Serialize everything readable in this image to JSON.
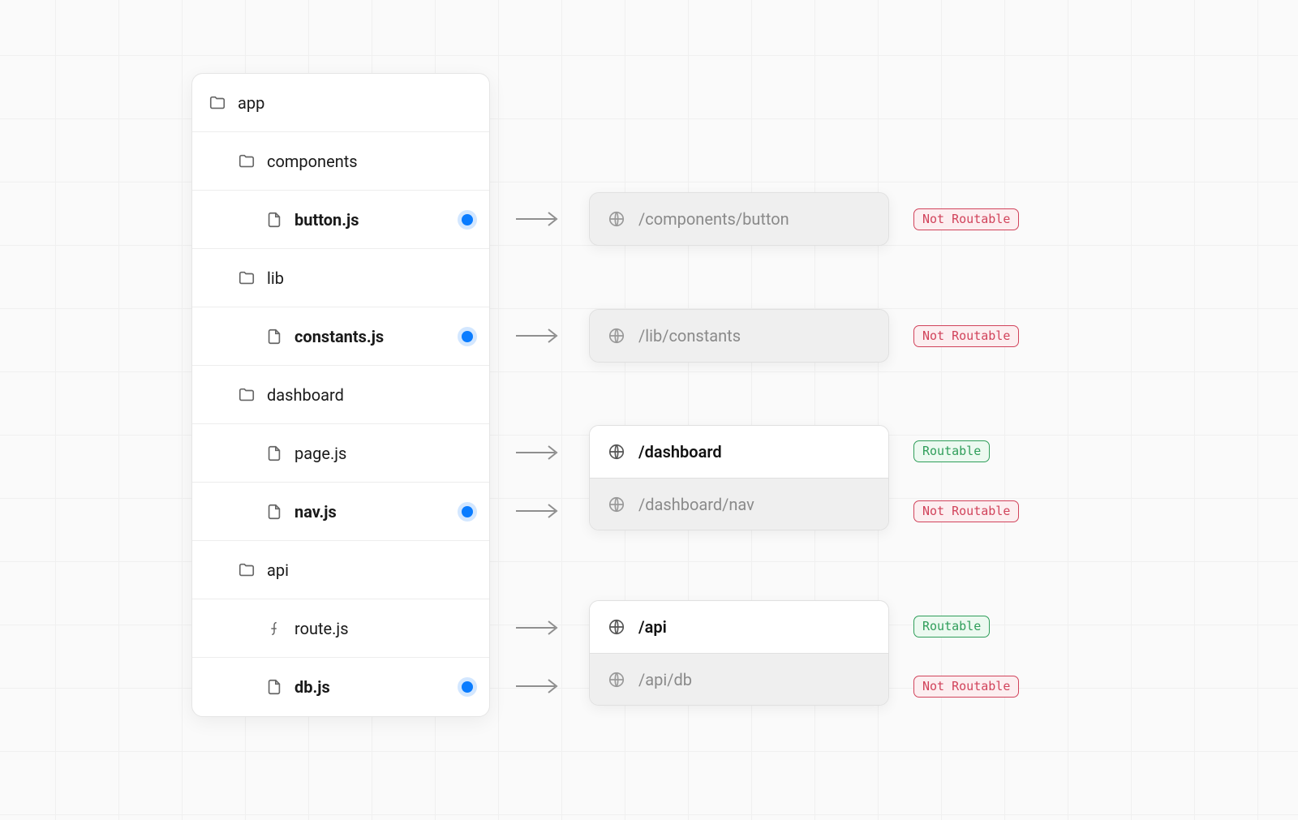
{
  "tree": {
    "root": "app",
    "components_folder": "components",
    "button_file": "button.js",
    "lib_folder": "lib",
    "constants_file": "constants.js",
    "dashboard_folder": "dashboard",
    "page_file": "page.js",
    "nav_file": "nav.js",
    "api_folder": "api",
    "route_file": "route.js",
    "db_file": "db.js"
  },
  "routes": {
    "components_button": "/components/button",
    "lib_constants": "/lib/constants",
    "dashboard": "/dashboard",
    "dashboard_nav": "/dashboard/nav",
    "api": "/api",
    "api_db": "/api/db"
  },
  "badges": {
    "routable": "Routable",
    "not_routable": "Not Routable"
  },
  "colors": {
    "dot": "#0a7cff",
    "badge_red": "#d1435b",
    "badge_green": "#2f9e5a"
  }
}
